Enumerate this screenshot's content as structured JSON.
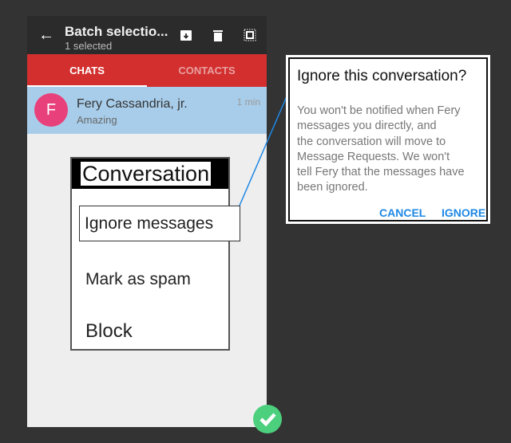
{
  "toolbar": {
    "title": "Batch selectio...",
    "subtitle": "1 selected",
    "icons": [
      "back-arrow-icon",
      "archive-icon",
      "trash-icon",
      "select-all-icon"
    ]
  },
  "tabs": [
    {
      "label": "CHATS",
      "active": true
    },
    {
      "label": "CONTACTS",
      "active": false
    }
  ],
  "chat": {
    "avatar_letter": "F",
    "name": "Fery Cassandria, jr.",
    "message": "Amazing",
    "time": "1 min"
  },
  "menu": {
    "title": "Conversation",
    "items": [
      "Ignore messages",
      "Mark as spam",
      "Block"
    ]
  },
  "dialog": {
    "title": "Ignore this conversation?",
    "body_lines": [
      "You won't be notified when Fery",
      "messages you directly, and",
      "the conversation will move to",
      "Message Requests. We won't",
      "tell Fery that the messages have",
      "been ignored."
    ],
    "cancel": "CANCEL",
    "ignore": "IGNORE"
  },
  "colors": {
    "toolbar": "#2b2b2b",
    "tabs": "#d32f2f",
    "selected_row": "#a8cdea",
    "avatar": "#e8407a",
    "fab": "#4cd07d",
    "accent": "#1e88e5"
  }
}
